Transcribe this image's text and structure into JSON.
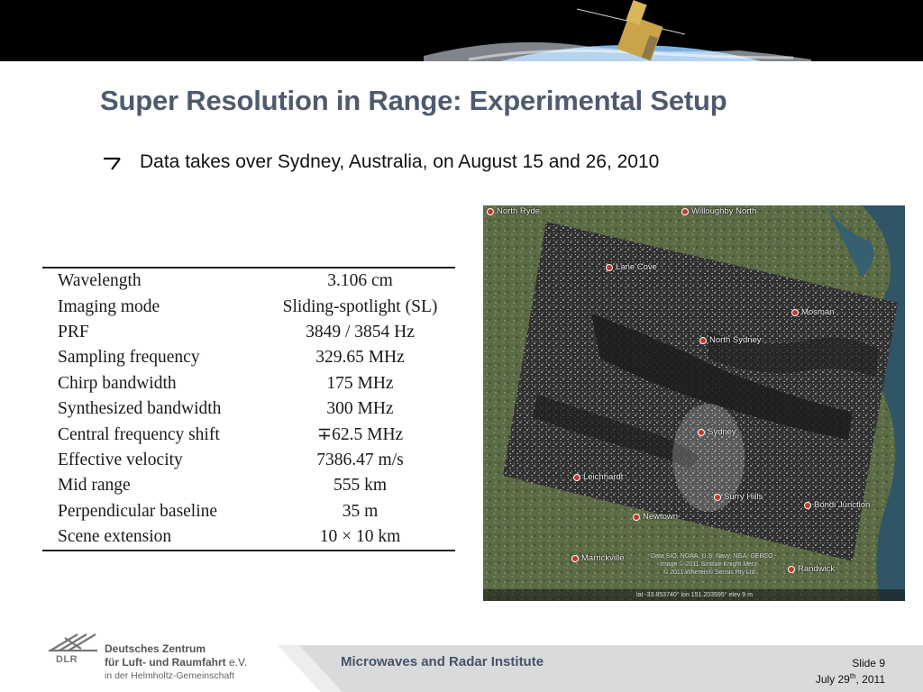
{
  "slide": {
    "title": "Super Resolution in Range: Experimental Setup",
    "bullet": "Data takes over Sydney, Australia, on August 15 and 26, 2010"
  },
  "params": [
    {
      "name": "Wavelength",
      "value": "3.106 cm"
    },
    {
      "name": "Imaging mode",
      "value": "Sliding-spotlight (SL)"
    },
    {
      "name": "PRF",
      "value": "3849 / 3854 Hz"
    },
    {
      "name": "Sampling frequency",
      "value": "329.65 MHz"
    },
    {
      "name": "Chirp bandwidth",
      "value": "175 MHz"
    },
    {
      "name": "Synthesized bandwidth",
      "value": "300 MHz"
    },
    {
      "name": "Central frequency shift",
      "value": "∓62.5 MHz"
    },
    {
      "name": "Effective velocity",
      "value": "7386.47 m/s"
    },
    {
      "name": "Mid range",
      "value": "555 km"
    },
    {
      "name": "Perpendicular baseline",
      "value": "35 m"
    },
    {
      "name": "Scene extension",
      "value": "10 × 10 km"
    }
  ],
  "map": {
    "places": {
      "north_ryde": "North Ryde",
      "willoughby_north": "Willoughby North",
      "lane_cove": "Lane Cove",
      "mosman": "Mosman",
      "north_sydney": "North Sydney",
      "sydney": "Sydney",
      "leichhardt": "Leichhardt",
      "surry_hills": "Surry Hills",
      "bondi_junction": "Bondi Junction",
      "newtown": "Newtown",
      "marrickville": "Marrickville",
      "randwick": "Randwick"
    },
    "attribution": {
      "line1": "Data SIO, NOAA, U.S. Navy, NGA, GEBCO",
      "line2": "Image © 2011 Sinclair Knight Merz",
      "line3": "© 2011 Whereis® Sensis Pty Ltd"
    },
    "coords": "lat -33.853740°  lon 151.203595°  elev 9 m"
  },
  "footer": {
    "logo_word": "DLR",
    "org_line1": "Deutsches Zentrum",
    "org_line2": "für Luft- und Raumfahrt",
    "org_ev": "e.V.",
    "org_line3": "in der Helmholtz-Gemeinschaft",
    "institute": "Microwaves and Radar Institute",
    "slide_label": "Slide 9",
    "date_prefix": "July 29",
    "date_sup": "th",
    "date_suffix": ", 2011"
  },
  "colors": {
    "title": "#4e5a6e",
    "footer_bar": "#d9dadc",
    "institute": "#47536a"
  }
}
